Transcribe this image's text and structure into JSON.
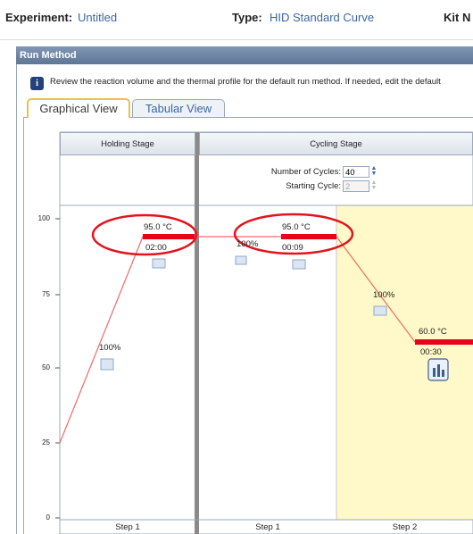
{
  "experiment": {
    "label": "Experiment:",
    "value": "Untitled"
  },
  "type": {
    "label": "Type:",
    "value": "HID Standard Curve"
  },
  "kit": {
    "label": "Kit N"
  },
  "run_method": {
    "title": "Run Method",
    "instruction": "Review the reaction volume and the thermal profile for the default run method. If needed, edit the default"
  },
  "tabs": {
    "graphical": "Graphical View",
    "tabular": "Tabular View"
  },
  "stages": {
    "holding": {
      "title": "Holding Stage",
      "steps": [
        "Step 1"
      ]
    },
    "cycling": {
      "title": "Cycling Stage",
      "cycles_label": "Number of Cycles:",
      "cycles_value": "40",
      "start_label": "Starting Cycle:",
      "start_value": "2",
      "steps": [
        "Step 1",
        "Step 2"
      ]
    }
  },
  "y_axis": {
    "ticks": [
      "100",
      "75",
      "50",
      "25",
      "0"
    ]
  },
  "profile": {
    "hold_temp": "95.0 °C",
    "hold_time": "02:00",
    "hold_ramp": "100%",
    "c1_temp": "95.0 °C",
    "c1_time": "00:09",
    "c1_ramp": "100%",
    "c2_temp": "60.0 °C",
    "c2_time": "00:30",
    "c2_ramp": "100%"
  },
  "colors": {
    "accent": "#e8001c",
    "highlight": "#fff8c8",
    "header": "#6c84a4"
  }
}
